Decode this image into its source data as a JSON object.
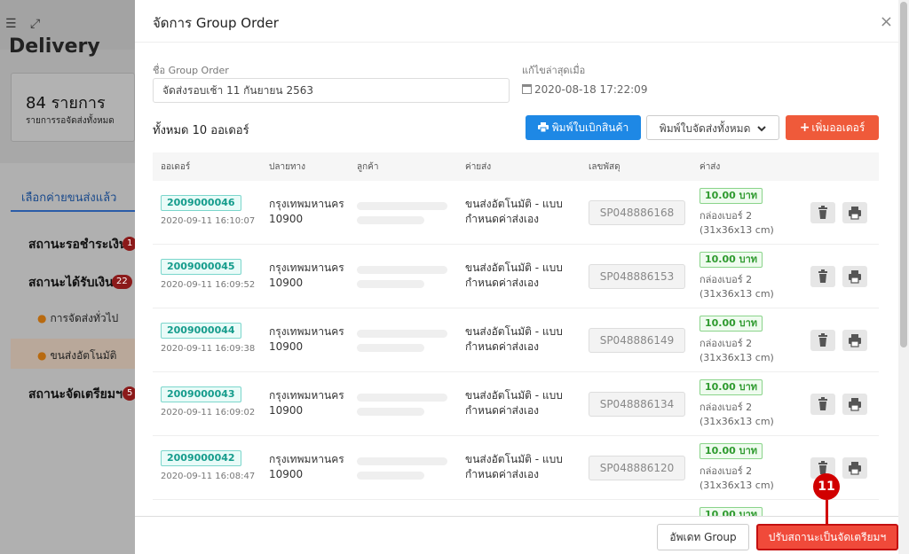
{
  "background": {
    "title": "Delivery",
    "card_count": "84 รายการ",
    "card_sub": "รายการรอจัดส่งทั้งหมด",
    "tab": "เลือกค่ายขนส่งแล้ว",
    "nav": [
      {
        "label": "สถานะรอชำระเงิน",
        "badge": "1"
      },
      {
        "label": "สถานะได้รับเงิน",
        "badge": "22"
      },
      {
        "label": "สถานะจัดเตรียมฯ",
        "badge": "5"
      }
    ],
    "sub_items": [
      "การจัดส่งทั่วไป",
      "ขนส่งอัตโนมัติ"
    ]
  },
  "modal": {
    "title": "จัดการ Group Order",
    "close": "×",
    "name_label": "ชื่อ Group Order",
    "name_value": "จัดส่งรอบเช้า 11 กันยายน 2563",
    "edited_label": "แก้ไขล่าสุดเมื่อ",
    "edited_value": "2020-08-18 17:22:09",
    "total": "ทั้งหมด 10 ออเดอร์",
    "btn_print_picking": "พิมพ์ใบเบิกสินค้า",
    "btn_print_all": "พิมพ์ใบจัดส่งทั้งหมด",
    "btn_add": "เพิ่มออเดอร์",
    "columns": [
      "ออเดอร์",
      "ปลายทาง",
      "ลูกค้า",
      "ค่ายส่ง",
      "เลขพัสดุ",
      "ค่าส่ง"
    ],
    "rows": [
      {
        "id": "2009000046",
        "date": "2020-09-11 16:10:07",
        "dest1": "กรุงเทพมหานคร",
        "dest2": "10900",
        "ship1": "ขนส่งอัตโนมัติ - แบบ",
        "ship2": "กำหนดค่าส่งเอง",
        "parcel": "SP048886168",
        "cost": "10.00 บาท",
        "box1": "กล่องเบอร์ 2",
        "box2": "(31x36x13 cm)"
      },
      {
        "id": "2009000045",
        "date": "2020-09-11 16:09:52",
        "dest1": "กรุงเทพมหานคร",
        "dest2": "10900",
        "ship1": "ขนส่งอัตโนมัติ - แบบ",
        "ship2": "กำหนดค่าส่งเอง",
        "parcel": "SP048886153",
        "cost": "10.00 บาท",
        "box1": "กล่องเบอร์ 2",
        "box2": "(31x36x13 cm)"
      },
      {
        "id": "2009000044",
        "date": "2020-09-11 16:09:38",
        "dest1": "กรุงเทพมหานคร",
        "dest2": "10900",
        "ship1": "ขนส่งอัตโนมัติ - แบบ",
        "ship2": "กำหนดค่าส่งเอง",
        "parcel": "SP048886149",
        "cost": "10.00 บาท",
        "box1": "กล่องเบอร์ 2",
        "box2": "(31x36x13 cm)"
      },
      {
        "id": "2009000043",
        "date": "2020-09-11 16:09:02",
        "dest1": "กรุงเทพมหานคร",
        "dest2": "10900",
        "ship1": "ขนส่งอัตโนมัติ - แบบ",
        "ship2": "กำหนดค่าส่งเอง",
        "parcel": "SP048886134",
        "cost": "10.00 บาท",
        "box1": "กล่องเบอร์ 2",
        "box2": "(31x36x13 cm)"
      },
      {
        "id": "2009000042",
        "date": "2020-09-11 16:08:47",
        "dest1": "กรุงเทพมหานคร",
        "dest2": "10900",
        "ship1": "ขนส่งอัตโนมัติ - แบบ",
        "ship2": "กำหนดค่าส่งเอง",
        "parcel": "SP048886120",
        "cost": "10.00 บาท",
        "box1": "กล่องเบอร์ 2",
        "box2": "(31x36x13 cm)"
      }
    ],
    "partial_row_cost": "10.00 บาท",
    "btn_update": "อัพเดท Group",
    "btn_status": "ปรับสถานะเป็นจัดเตรียมฯ"
  },
  "step_marker": "11",
  "icons": {
    "menu": "menu-collapse-icon",
    "fullscreen": "fullscreen-icon",
    "print": "print-icon",
    "plus": "plus-icon",
    "calendar": "calendar-icon",
    "trash": "trash-icon",
    "chevron": "chevron-down-icon"
  },
  "colors": {
    "primary_blue": "#1e88e5",
    "danger_red": "#ef5a3a",
    "id_teal": "#159c8c",
    "cost_green": "#2e9a2e"
  }
}
